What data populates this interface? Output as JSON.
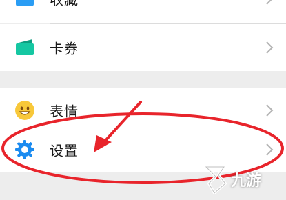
{
  "menu": {
    "items": [
      {
        "label": "收藏",
        "icon": "favorites-icon"
      },
      {
        "label": "卡券",
        "icon": "card-coupon-icon"
      },
      {
        "label": "表情",
        "icon": "emoji-smiley-icon"
      },
      {
        "label": "设置",
        "icon": "settings-gear-icon"
      }
    ]
  },
  "annotation": {
    "highlight": "settings-item",
    "color": "#e8242b"
  },
  "watermark": {
    "text": "九游",
    "logo": "jiuyou-logo-icon"
  },
  "colors": {
    "coupon_green": "#15c7a2",
    "emoji_yellow": "#f8c83a",
    "gear_blue": "#1a8bf0",
    "favorites_blue": "#2a9df4"
  }
}
